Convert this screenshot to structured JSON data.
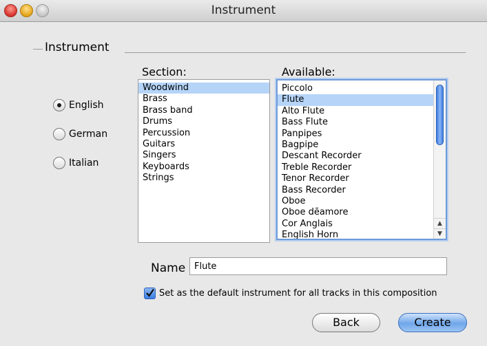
{
  "window": {
    "title": "Instrument"
  },
  "fieldset": {
    "label": "Instrument"
  },
  "language": {
    "options": [
      "English",
      "German",
      "Italian"
    ],
    "selected": "English"
  },
  "section": {
    "label": "Section:",
    "items": [
      "Woodwind",
      "Brass",
      "Brass band",
      "Drums",
      "Percussion",
      "Guitars",
      "Singers",
      "Keyboards",
      "Strings"
    ],
    "selected": "Woodwind"
  },
  "available": {
    "label": "Available:",
    "items": [
      "Piccolo",
      "Flute",
      "Alto Flute",
      "Bass Flute",
      "Panpipes",
      "Bagpipe",
      "Descant Recorder",
      "Treble Recorder",
      "Tenor Recorder",
      "Bass Recorder",
      "Oboe",
      "Oboe dēamore",
      "Cor Anglais",
      "English Horn"
    ],
    "selected": "Flute"
  },
  "name_field": {
    "label": "Name",
    "value": "Flute"
  },
  "default_checkbox": {
    "label": "Set as the default instrument for all tracks in this composition",
    "checked": true
  },
  "buttons": {
    "back": "Back",
    "create": "Create"
  },
  "icons": {
    "close": "close-icon",
    "minimize": "minimize-icon",
    "zoom": "zoom-icon",
    "scroll_up": "arrow-up-icon",
    "scroll_down": "arrow-down-icon",
    "check": "checkmark-icon"
  },
  "colors": {
    "selection": "#b5d4f8",
    "accent": "#3a7ce3"
  }
}
